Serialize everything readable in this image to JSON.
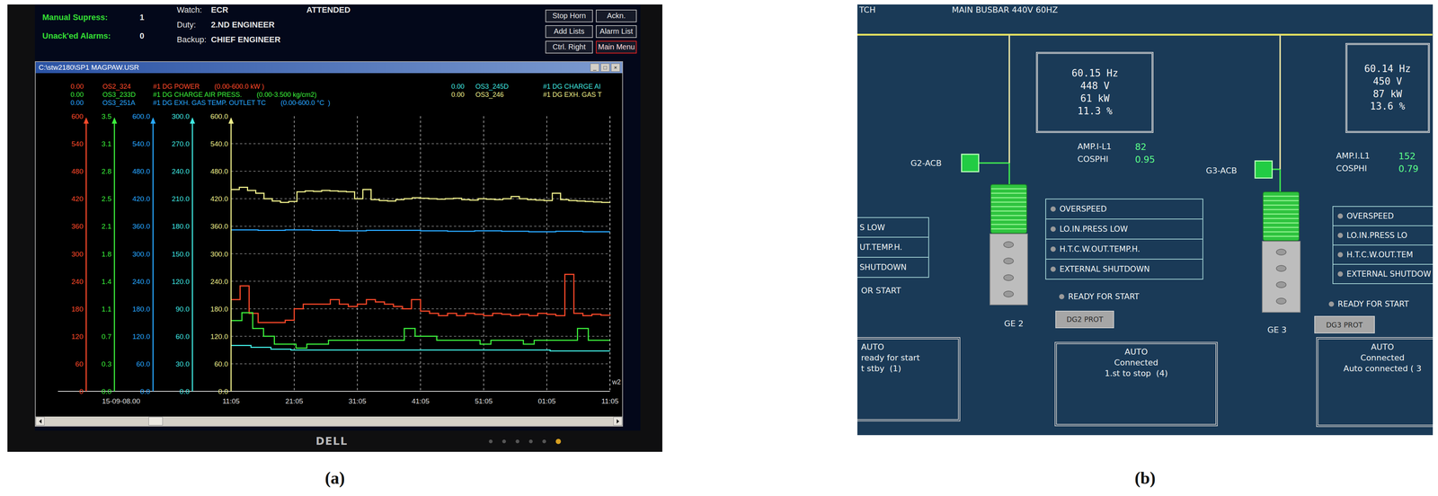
{
  "figure_labels": [
    "(a)",
    "(b)"
  ],
  "panel_a": {
    "monitor": {
      "brand": "DELL"
    },
    "header": {
      "counters": [
        {
          "label": "Manual Supress:",
          "value": "1"
        },
        {
          "label": "Unack'ed Alarms:",
          "value": "0"
        }
      ],
      "fields": [
        {
          "label": "Watch:",
          "value": "ECR"
        },
        {
          "label": "Duty:",
          "value": "2.ND ENGINEER"
        },
        {
          "label": "Backup:",
          "value": "CHIEF ENGINEER"
        }
      ],
      "status": "ATTENDED",
      "buttons": [
        {
          "label": "Stop Horn",
          "kind": "normal"
        },
        {
          "label": "Ackn.",
          "kind": "normal"
        },
        {
          "label": "Add Lists",
          "kind": "normal"
        },
        {
          "label": "Alarm List",
          "kind": "normal"
        },
        {
          "label": "Ctrl. Right",
          "kind": "normal"
        },
        {
          "label": "Main Menu",
          "kind": "alert"
        }
      ]
    },
    "window": {
      "title": "C:\\stw2180\\SP1 MAGPAW.USR",
      "controls": [
        "_",
        "□",
        "×"
      ]
    },
    "chart": {
      "series": [
        {
          "value": "0.00",
          "tag": "OS2_324",
          "name": "#1 DG POWER",
          "range": "(0.00-600.0 kW )",
          "color": "#ff4a2a",
          "ticks": [
            "600",
            "540",
            "480",
            "420",
            "360",
            "300",
            "240",
            "180",
            "120",
            "60",
            "0"
          ],
          "values": [
            200,
            230,
            170,
            150,
            150,
            150,
            155,
            180,
            190,
            190,
            190,
            200,
            190,
            185,
            190,
            200,
            195,
            190,
            185,
            180,
            200,
            175,
            170,
            165,
            170,
            165,
            170,
            168,
            165,
            170,
            168,
            165,
            168,
            165,
            170,
            168,
            165,
            255,
            170,
            165,
            168,
            166,
            165
          ]
        },
        {
          "value": "0.00",
          "tag": "OS3_233D",
          "name": "#1 DG CHARGE AIR PRESS.",
          "range": "(0.00-3.500 kg/cm2)",
          "color": "#3cf03c",
          "ticks": [
            "3.5",
            "3.1",
            "2.8",
            "2.5",
            "2.1",
            "1.8",
            "1.4",
            "1.1",
            "0.7",
            "0.3",
            "0.0"
          ],
          "values": [
            0.9,
            1.0,
            0.8,
            0.7,
            0.6,
            0.6,
            0.55,
            0.6,
            0.6,
            0.65,
            0.65,
            0.65,
            0.65,
            0.65,
            0.65,
            0.65,
            0.8,
            0.7,
            0.7,
            0.65,
            0.65,
            0.65,
            0.65,
            0.6,
            0.65,
            0.65,
            0.65,
            0.6,
            0.65,
            0.65,
            0.65,
            0.65,
            0.8,
            0.65,
            0.65,
            0.65
          ]
        },
        {
          "value": "0.00",
          "tag": "OS3_251A",
          "name": "#1 DG EXH. GAS TEMP. OUTLET TC",
          "range": "(0.00-600.0 °C  )",
          "color": "#28a8ff",
          "ticks": [
            "600.0",
            "540.0",
            "480.0",
            "420.0",
            "360.0",
            "300.0",
            "240.0",
            "180.0",
            "120.0",
            "60.0",
            "0.0"
          ],
          "values": [
            352,
            351,
            352,
            351,
            350,
            351,
            351,
            350,
            349,
            350,
            349,
            348,
            349,
            348,
            348
          ]
        },
        {
          "value": "0.00",
          "tag": "OS3_245D",
          "name": "#1 DG CHARGE AI",
          "color": "#40e8e0",
          "ticks": [
            "300.0",
            "270.0",
            "240.0",
            "210.0",
            "180.0",
            "150.0",
            "120.0",
            "90.0",
            "60.0",
            "30.0",
            "0.0"
          ],
          "values": [
            50,
            48,
            46,
            45,
            45,
            45,
            45,
            45,
            45,
            45,
            45,
            45,
            45,
            45,
            45,
            45,
            44,
            44,
            44,
            44
          ]
        },
        {
          "value": "0.00",
          "tag": "OS3_246",
          "name": "#1 DG EXH. GAS T",
          "color": "#f0f08c",
          "ticks": [
            "600.0",
            "540.0",
            "480.0",
            "420.0",
            "360.0",
            "300.0",
            "240.0",
            "180.0",
            "120.0",
            "60.0",
            "0.0"
          ],
          "values": [
            440,
            445,
            438,
            432,
            420,
            415,
            412,
            414,
            435,
            437,
            436,
            438,
            437,
            436,
            435,
            420,
            440,
            418,
            416,
            415,
            418,
            420,
            422,
            421,
            420,
            419,
            420,
            421,
            418,
            417,
            420,
            419,
            418,
            420,
            425,
            420,
            418,
            417,
            416,
            432,
            418,
            416,
            415,
            414,
            413,
            412,
            411
          ]
        }
      ],
      "date_label": "15-09-08.00",
      "x_labels": [
        "11:05",
        "21:05",
        "31:05",
        "41:05",
        "51:05",
        "01:05",
        "11:05"
      ],
      "edge_text": "w2"
    }
  },
  "panel_b": {
    "corner_text": "TCH",
    "title": "MAIN BUSBAR 440V 60HZ",
    "partial_generator": {
      "alarms": [
        "S LOW",
        "UT.TEMP.H.",
        "SHUTDOWN"
      ],
      "ready": "OR START",
      "status": [
        "AUTO",
        "ready for start",
        "t stby  (1)"
      ]
    },
    "generators": [
      {
        "name": "GE 2",
        "acb": "G2-ACB",
        "acb_closed": true,
        "meter": [
          "60.15 Hz",
          "448 V",
          "61 kW",
          "11.3 %"
        ],
        "amp_label": "AMP.I-L1",
        "amp": "82",
        "cosphi_label": "COSPHI",
        "cosphi": "0.95",
        "alarms": [
          {
            "label": "OVERSPEED",
            "active": false
          },
          {
            "label": "LO.IN.PRESS LOW",
            "active": false
          },
          {
            "label": "H.T.C.W.OUT.TEMP.H.",
            "active": false
          },
          {
            "label": "EXTERNAL SHUTDOWN",
            "active": false
          }
        ],
        "ready": {
          "label": "READY FOR START",
          "active": false
        },
        "prot": "DG2 PROT",
        "status": [
          "AUTO",
          "Connected",
          "1.st to stop  (4)"
        ]
      },
      {
        "name": "GE 3",
        "acb": "G3-ACB",
        "acb_closed": true,
        "meter": [
          "60.14 Hz",
          "450 V",
          "87 kW",
          "13.6 %"
        ],
        "amp_label": "AMP.I.L1",
        "amp": "152",
        "cosphi_label": "COSPHI",
        "cosphi": "0.79",
        "alarms": [
          {
            "label": "OVERSPEED",
            "active": false
          },
          {
            "label": "LO.IN.PRESS LO",
            "active": false
          },
          {
            "label": "H.T.C.W.OUT.TEM",
            "active": false
          },
          {
            "label": "EXTERNAL SHUTDOW",
            "active": false
          }
        ],
        "ready": {
          "label": "READY FOR START",
          "active": false
        },
        "prot": "DG3 PROT",
        "status": [
          "AUTO",
          "Connected",
          "Auto connected ( 3"
        ]
      }
    ]
  }
}
